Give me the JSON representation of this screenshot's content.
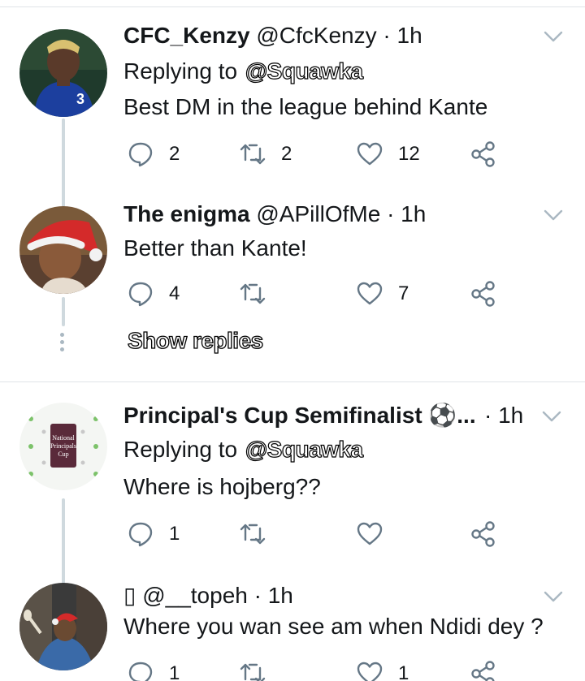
{
  "tweets": [
    {
      "name": "CFC_Kenzy",
      "handle": "@CfcKenzy",
      "dot": "·",
      "time": "1h",
      "replying_prefix": "Replying to",
      "replying_to": "@Squawka",
      "text": "Best DM in the league behind Kante",
      "replies": "2",
      "retweets": "2",
      "likes": "12"
    },
    {
      "name": "The enigma",
      "handle": "@APillOfMe",
      "dot": "·",
      "time": "1h",
      "text": "Better than Kante!",
      "replies": "4",
      "retweets": "",
      "likes": "7"
    },
    {
      "name": "Principal's Cup Semifinalist ⚽...",
      "handle": "",
      "dot": "·",
      "time": "1h",
      "replying_prefix": "Replying to",
      "replying_to": "@Squawka",
      "text": "Where is hojberg??",
      "replies": "1",
      "retweets": "",
      "likes": ""
    },
    {
      "name": "▯",
      "handle": "@__topeh",
      "dot": "·",
      "time": "1h",
      "text": "Where you wan see am when Ndidi dey ?",
      "replies": "1",
      "retweets": "",
      "likes": "1"
    }
  ],
  "show_replies": "Show replies",
  "avatar_text": {
    "principals_cup": [
      "National",
      "Principals",
      "Cup"
    ]
  },
  "icons": [
    "reply-icon",
    "retweet-icon",
    "like-icon",
    "share-icon",
    "chevron-down-icon"
  ],
  "colors": {
    "text": "#14171a",
    "icon": "#657786",
    "divider": "#dfe3e7",
    "thread": "#cfd9de"
  }
}
